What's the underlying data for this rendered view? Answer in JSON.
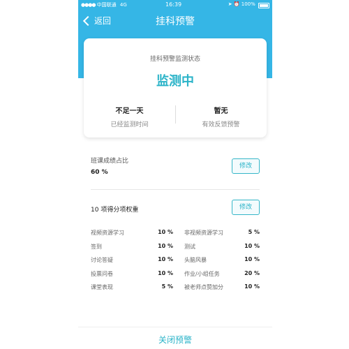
{
  "status_bar": {
    "carrier": "中国联通",
    "network": "4G",
    "time": "16:39",
    "battery": "100%"
  },
  "nav": {
    "back_label": "返回",
    "title": "挂科预警"
  },
  "monitor_card": {
    "label": "挂科预警监测状态",
    "status": "监测中",
    "stats": [
      {
        "value": "不足一天",
        "label": "已经监测时间"
      },
      {
        "value": "暂无",
        "label": "有效反馈预警"
      }
    ]
  },
  "grade_ratio": {
    "title": "班课成绩占比",
    "value": "60 %",
    "edit_label": "修改"
  },
  "weights": {
    "title": "10 项得分项权重",
    "edit_label": "修改",
    "rows": [
      {
        "left_name": "视频资源学习",
        "left_value": "10 %",
        "right_name": "非视频资源学习",
        "right_value": "5 %"
      },
      {
        "left_name": "签到",
        "left_value": "10 %",
        "right_name": "测试",
        "right_value": "10 %"
      },
      {
        "left_name": "讨论答疑",
        "left_value": "10 %",
        "right_name": "头脑风暴",
        "right_value": "10 %"
      },
      {
        "left_name": "投票问卷",
        "left_value": "10 %",
        "right_name": "作业/小组任务",
        "right_value": "20 %"
      },
      {
        "left_name": "课堂表现",
        "left_value": "5 %",
        "right_name": "被老师点赞加分",
        "right_value": "10 %"
      }
    ]
  },
  "footer": {
    "close_label": "关闭预警"
  },
  "colors": {
    "header": "#35b6e6",
    "accent": "#2ab3c8"
  }
}
